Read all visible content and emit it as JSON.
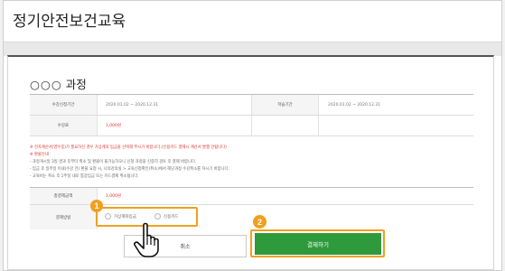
{
  "page": {
    "title": "정기안전보건교육"
  },
  "course": {
    "dots": "○○○",
    "name": "과정"
  },
  "info": {
    "apply_period_label": "수강신청기간",
    "apply_period_value": "2020.01.02 ~ 2020.12.31",
    "study_period_label": "학습기간",
    "study_period_value": "2020.01.02 ~ 2020.12.31",
    "fee_label": "수강료",
    "fee_value": "1,000원"
  },
  "notes": {
    "warning": "※ 전자계산서(영수증)가 필요하신 경우 가상계좌 입금을 선택해 주시기 바랍니다.(신용카드 결제시 계산서 발행 안됩니다)",
    "refund_heading": "※ 환불안내",
    "lines": [
      "- 과정개시일 3일 경과 후부터 취소 및 환불이 불가능하오니 신청 과정을 신중히 검토 후 결제 바랍니다.",
      "- 입금 후 일주일 이내(수강 전) 환불 요청 시, 나의강의실 > 교육신청확인(취소)에서 해당과정 수강취소를 하시기 바랍니다.",
      "- 교육비는 취소 후 1주일 내로 통장입금 또는 카드결제 취소됩니다."
    ]
  },
  "payment": {
    "total_label": "총결제금액",
    "total_value": "1,000원",
    "method_label": "결제방법",
    "options": [
      "가상계좌입금",
      "신용카드"
    ]
  },
  "buttons": {
    "cancel": "취소",
    "pay": "결제하기"
  },
  "callouts": {
    "one": "1",
    "two": "2"
  },
  "colors": {
    "accent": "#f0a020",
    "pay": "#2f9a3b",
    "price": "#d9342b"
  },
  "icons": {
    "pointer": "hand-pointer-icon"
  }
}
